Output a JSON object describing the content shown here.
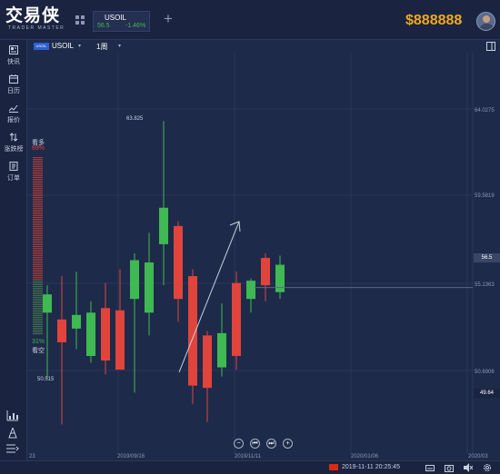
{
  "app": {
    "logo_text": "交易侠",
    "logo_subtitle": "TRADER MASTER",
    "balance": "$888888"
  },
  "symbol_tab": {
    "symbol": "USOIL",
    "price": "56.5",
    "change": "-1.46%"
  },
  "sidebar": {
    "items": [
      {
        "label": "快讯",
        "icon": "flash-news-icon"
      },
      {
        "label": "日历",
        "icon": "calendar-icon"
      },
      {
        "label": "报价",
        "icon": "quote-chart-icon"
      },
      {
        "label": "涨跌榜",
        "icon": "sort-arrows-icon"
      },
      {
        "label": "订单",
        "icon": "order-icon"
      }
    ],
    "bottom_tools": [
      "indicator-icon",
      "pen-icon",
      "wave-icon",
      "menu-expand-icon"
    ]
  },
  "chart_header": {
    "badge": "USOIL",
    "symbol": "USOIL",
    "timeframe": "1周"
  },
  "sentiment": {
    "bull_label": "看多",
    "bull_pct": "69%",
    "bear_pct": "31%",
    "bear_label": "看空",
    "bull_fraction": 0.69
  },
  "price_axis": {
    "labels": [
      "64.0275",
      "59.5819",
      "55.1363",
      "50.6906"
    ],
    "current_price": "56.5",
    "crosshair_price": "49.64"
  },
  "annotations": {
    "high": "63.825",
    "low": "50.515"
  },
  "nav_buttons": [
    "−",
    "⏮",
    "⏭",
    "+"
  ],
  "x_axis": {
    "labels": [
      "23",
      "2019/09/16",
      "2019/11/11",
      "2020/01/06",
      "2020/03"
    ]
  },
  "status": {
    "datetime": "2019-11-11 20:25:45"
  },
  "colors": {
    "bull": "#3fb952",
    "bear": "#e0443c",
    "background": "#1e2a4a",
    "balance": "#f0a81d"
  },
  "chart_data": {
    "type": "candlestick",
    "ylim": [
      49.2,
      66.8
    ],
    "candles": [
      {
        "o": 55.4,
        "h": 56.6,
        "l": 52.5,
        "c": 56.2
      },
      {
        "o": 55.1,
        "h": 57.0,
        "l": 50.5,
        "c": 54.1
      },
      {
        "o": 54.7,
        "h": 57.2,
        "l": 53.8,
        "c": 55.3
      },
      {
        "o": 53.5,
        "h": 55.9,
        "l": 53.2,
        "c": 55.4
      },
      {
        "o": 55.6,
        "h": 56.7,
        "l": 52.7,
        "c": 53.3
      },
      {
        "o": 55.5,
        "h": 57.3,
        "l": 53.1,
        "c": 52.9
      },
      {
        "o": 56.0,
        "h": 58.0,
        "l": 51.9,
        "c": 57.7
      },
      {
        "o": 55.4,
        "h": 58.9,
        "l": 54.4,
        "c": 57.6
      },
      {
        "o": 58.4,
        "h": 63.8,
        "l": 56.6,
        "c": 60.0
      },
      {
        "o": 59.2,
        "h": 59.4,
        "l": 55.0,
        "c": 56.0
      },
      {
        "o": 57.0,
        "h": 57.3,
        "l": 51.4,
        "c": 52.2
      },
      {
        "o": 54.4,
        "h": 54.6,
        "l": 50.6,
        "c": 52.1
      },
      {
        "o": 53.0,
        "h": 55.8,
        "l": 52.6,
        "c": 54.5
      },
      {
        "o": 56.7,
        "h": 57.2,
        "l": 52.9,
        "c": 53.5
      },
      {
        "o": 56.0,
        "h": 56.9,
        "l": 55.4,
        "c": 56.8
      },
      {
        "o": 57.8,
        "h": 58.0,
        "l": 55.9,
        "c": 56.6
      },
      {
        "o": 56.3,
        "h": 57.9,
        "l": 56.0,
        "c": 57.5
      }
    ]
  }
}
